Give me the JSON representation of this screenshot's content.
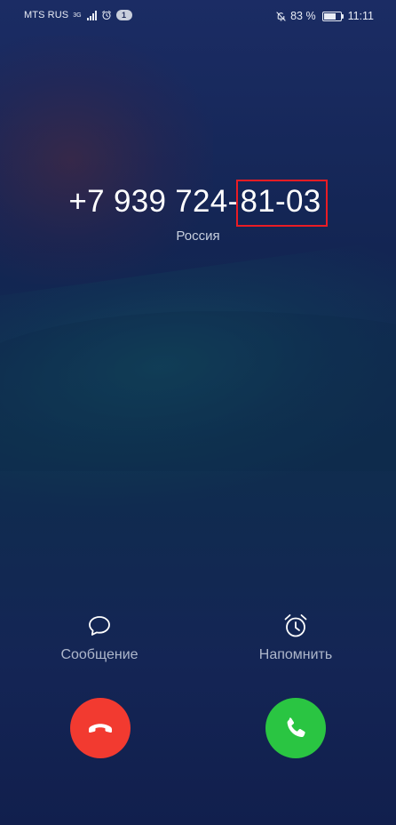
{
  "status_bar": {
    "carrier": "MTS RUS",
    "network_type": "3G",
    "notification_count": "1",
    "battery_percent": "83 %",
    "battery_level": 0.83,
    "time": "11:11"
  },
  "caller": {
    "number_prefix": "+7 939 724-",
    "number_suffix": "81-03",
    "region": "Россия"
  },
  "quick_actions": {
    "message_label": "Сообщение",
    "remind_label": "Напомнить"
  },
  "colors": {
    "decline": "#f23a30",
    "accept": "#2ac542",
    "highlight_box": "#ea1c24"
  },
  "icons": {
    "message": "speech-bubble-icon",
    "remind": "alarm-clock-icon",
    "decline": "phone-hangup-icon",
    "accept": "phone-icon",
    "mute": "bell-off-icon"
  }
}
